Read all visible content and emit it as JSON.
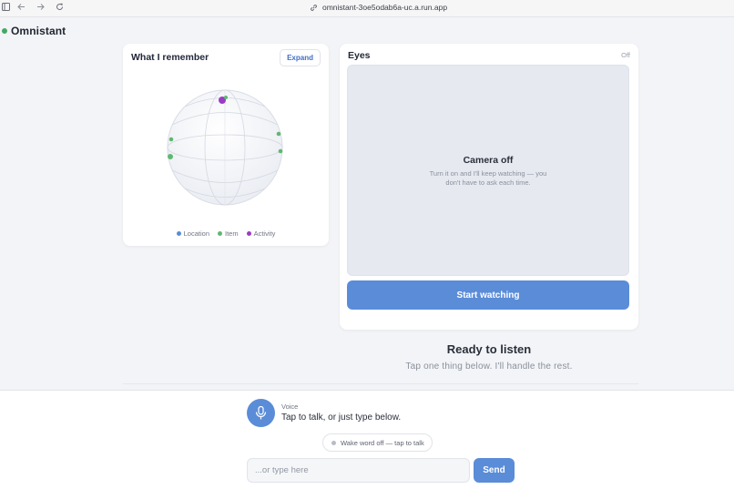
{
  "browser": {
    "url": "omnistant-3oe5odab6a-uc.a.run.app"
  },
  "app": {
    "name": "Omnistant",
    "status_color": "#43a863"
  },
  "memory": {
    "title": "What I remember",
    "expand_label": "Expand",
    "legend": [
      {
        "label": "Location",
        "color": "#5a8cd8"
      },
      {
        "label": "Item",
        "color": "#5fb872"
      },
      {
        "label": "Activity",
        "color": "#9b3bc5"
      }
    ]
  },
  "eyes": {
    "title": "Eyes",
    "status": "Off",
    "camera_title": "Camera off",
    "camera_desc": "Turn it on and I'll keep watching — you don't have to ask each time.",
    "start_label": "Start watching"
  },
  "ready": {
    "title": "Ready to listen",
    "subtitle": "Tap one thing below. I'll handle the rest."
  },
  "composer": {
    "voice_label": "Voice",
    "voice_hint": "Tap to talk, or just type below.",
    "wake_word": "Wake word off — tap to talk",
    "input_placeholder": "...or type here",
    "send_label": "Send"
  },
  "colors": {
    "accent": "#5a8cd8",
    "item": "#5fb872",
    "activity": "#9b3bc5"
  }
}
